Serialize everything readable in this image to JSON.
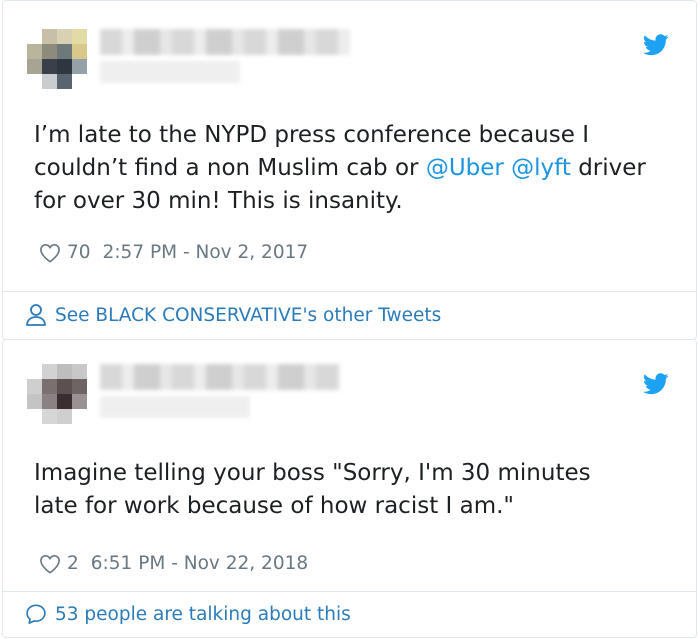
{
  "tweets": [
    {
      "text_prefix": "I’m late to the NYPD press conference because I couldn’t find a non Muslim cab or ",
      "mention1": "@Uber",
      "between": " ",
      "mention2": "@lyft",
      "text_suffix": " driver for over 30 min!  This is  insanity.",
      "likes": "70",
      "timestamp": "2:57 PM - Nov 2, 2017",
      "footer": "See BLACK CONSERVATIVE's other Tweets",
      "footer_icon": "person-icon"
    },
    {
      "text": "Imagine telling your boss \"Sorry, I'm 30 minutes late for work because of how racist I am.\"",
      "likes": "2",
      "timestamp": "6:51 PM - Nov 22, 2018",
      "footer": "53 people are talking about this",
      "footer_icon": "speech-bubble-icon"
    }
  ],
  "colors": {
    "link": "#1b95e0",
    "footer_link": "#2b7bb9",
    "meta": "#697882",
    "border": "#e1e8ed",
    "twitter_blue": "#1da1f2"
  },
  "icons": [
    "twitter-bird-icon",
    "heart-icon",
    "person-icon",
    "speech-bubble-icon"
  ]
}
